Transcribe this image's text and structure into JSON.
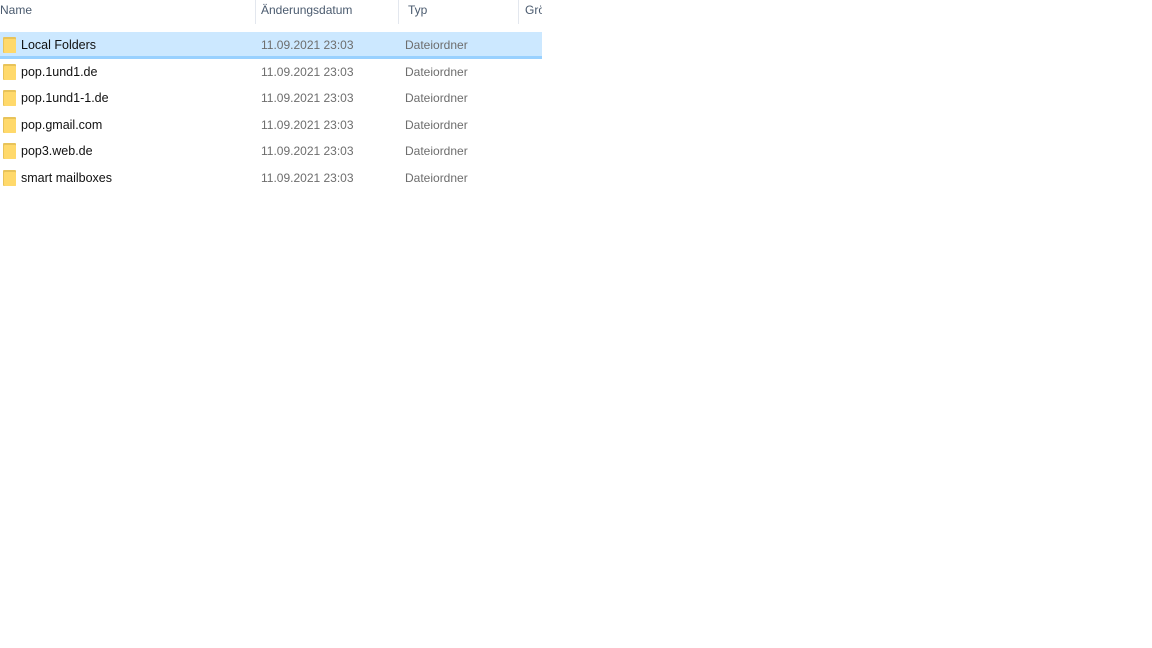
{
  "columns": {
    "name": "Name",
    "date": "Änderungsdatum",
    "type": "Typ",
    "size": "Grö"
  },
  "rows": [
    {
      "name": "Local Folders",
      "date": "11.09.2021 23:03",
      "type": "Dateiordner",
      "icon": "folder-icon",
      "selected": true
    },
    {
      "name": "pop.1und1.de",
      "date": "11.09.2021 23:03",
      "type": "Dateiordner",
      "icon": "folder-icon"
    },
    {
      "name": "pop.1und1-1.de",
      "date": "11.09.2021 23:03",
      "type": "Dateiordner",
      "icon": "folder-icon"
    },
    {
      "name": "pop.gmail.com",
      "date": "11.09.2021 23:03",
      "type": "Dateiordner",
      "icon": "folder-icon"
    },
    {
      "name": "pop3.web.de",
      "date": "11.09.2021 23:03",
      "type": "Dateiordner",
      "icon": "folder-icon"
    },
    {
      "name": "smart mailboxes",
      "date": "11.09.2021 23:03",
      "type": "Dateiordner",
      "icon": "folder-icon"
    }
  ],
  "colors": {
    "selection_bg": "#cce8ff",
    "selection_border": "#99d1ff",
    "folder_yellow": "#ffd96b"
  }
}
